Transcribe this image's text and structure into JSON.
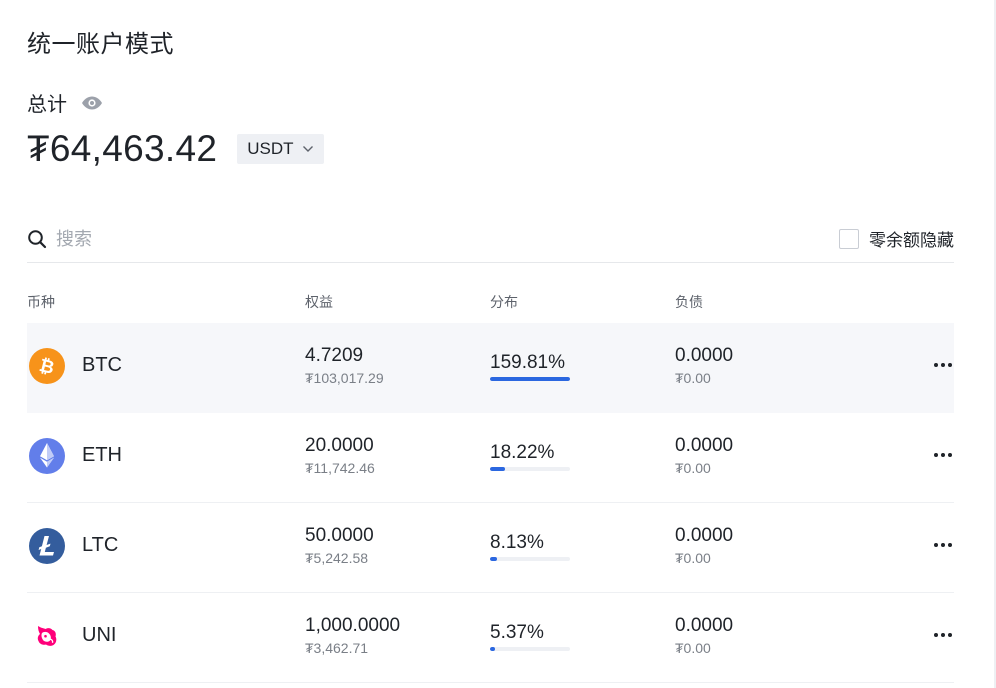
{
  "page": {
    "title": "统一账户模式"
  },
  "summary": {
    "total_label": "总计",
    "balance": "₮64,463.42",
    "currency": "USDT"
  },
  "search": {
    "placeholder": "搜索",
    "hide_zero_label": "零余额隐藏",
    "hide_zero_checked": false
  },
  "table": {
    "headers": {
      "coin": "币种",
      "equity": "权益",
      "distribution": "分布",
      "liability": "负债"
    },
    "rows": [
      {
        "coin": "BTC",
        "icon": "btc-icon",
        "equity": "4.7209",
        "equity_value": "₮103,017.29",
        "distribution": "159.81%",
        "distribution_fraction": 1.0,
        "liability": "0.0000",
        "liability_value": "₮0.00",
        "highlighted": true
      },
      {
        "coin": "ETH",
        "icon": "eth-icon",
        "equity": "20.0000",
        "equity_value": "₮11,742.46",
        "distribution": "18.22%",
        "distribution_fraction": 0.1822,
        "liability": "0.0000",
        "liability_value": "₮0.00",
        "highlighted": false
      },
      {
        "coin": "LTC",
        "icon": "ltc-icon",
        "equity": "50.0000",
        "equity_value": "₮5,242.58",
        "distribution": "8.13%",
        "distribution_fraction": 0.0813,
        "liability": "0.0000",
        "liability_value": "₮0.00",
        "highlighted": false
      },
      {
        "coin": "UNI",
        "icon": "uni-icon",
        "equity": "1,000.0000",
        "equity_value": "₮3,462.71",
        "distribution": "5.37%",
        "distribution_fraction": 0.0537,
        "liability": "0.0000",
        "liability_value": "₮0.00",
        "highlighted": false
      }
    ]
  },
  "colors": {
    "accent": "#2b67e0",
    "btc": "#f7931a",
    "eth": "#627eea",
    "ltc": "#345d9d",
    "uni": "#ff007a"
  }
}
